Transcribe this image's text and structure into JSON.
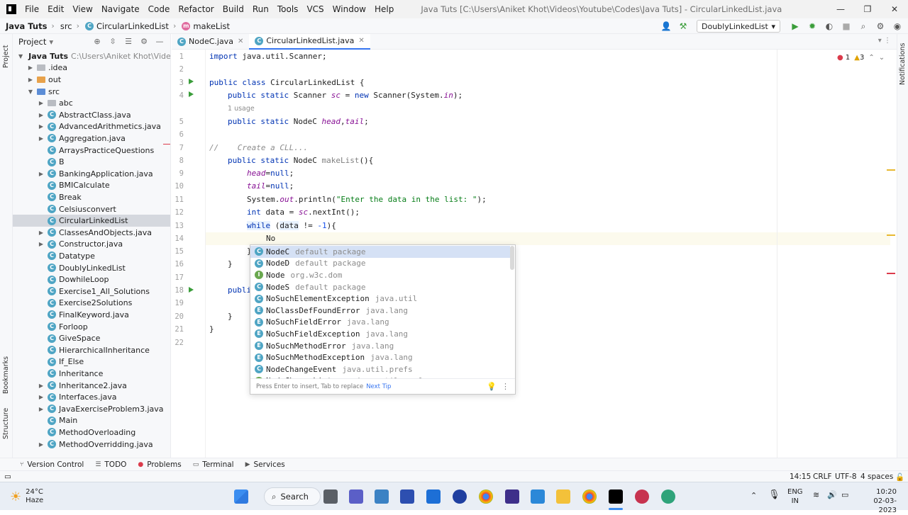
{
  "window": {
    "menu": [
      "File",
      "Edit",
      "View",
      "Navigate",
      "Code",
      "Refactor",
      "Build",
      "Run",
      "Tools",
      "VCS",
      "Window",
      "Help"
    ],
    "title": "Java Tuts [C:\\Users\\Aniket Khot\\Videos\\Youtube\\Codes\\Java Tuts] - CircularLinkedList.java",
    "controls": [
      "—",
      "❐",
      "✕"
    ]
  },
  "navbar": {
    "project": "Java Tuts",
    "src": "src",
    "file": "CircularLinkedList",
    "method": "makeList",
    "run_config": "DoublyLinkedList"
  },
  "project_panel": {
    "title": "Project",
    "root_name": "Java Tuts",
    "root_path": "C:\\Users\\Aniket Khot\\Videos\\Yo",
    "items": [
      {
        "label": ".idea",
        "type": "folder",
        "indent": 1,
        "arrow": "▶"
      },
      {
        "label": "out",
        "type": "folder-orange",
        "indent": 1,
        "arrow": "▶"
      },
      {
        "label": "src",
        "type": "folder-blue",
        "indent": 1,
        "arrow": "▼"
      },
      {
        "label": "abc",
        "type": "folder",
        "indent": 2,
        "arrow": "▶"
      },
      {
        "label": "AbstractClass.java",
        "type": "class",
        "indent": 2,
        "arrow": "▶"
      },
      {
        "label": "AdvancedArithmetics.java",
        "type": "class",
        "indent": 2,
        "arrow": "▶"
      },
      {
        "label": "Aggregation.java",
        "type": "class",
        "indent": 2,
        "arrow": "▶"
      },
      {
        "label": "ArraysPracticeQuestions",
        "type": "class",
        "indent": 2,
        "arrow": ""
      },
      {
        "label": "B",
        "type": "class",
        "indent": 2,
        "arrow": ""
      },
      {
        "label": "BankingApplication.java",
        "type": "class",
        "indent": 2,
        "arrow": "▶"
      },
      {
        "label": "BMICalculate",
        "type": "class",
        "indent": 2,
        "arrow": ""
      },
      {
        "label": "Break",
        "type": "class",
        "indent": 2,
        "arrow": ""
      },
      {
        "label": "Celsiusconvert",
        "type": "class",
        "indent": 2,
        "arrow": ""
      },
      {
        "label": "CircularLinkedList",
        "type": "class",
        "indent": 2,
        "arrow": "",
        "selected": true
      },
      {
        "label": "ClassesAndObjects.java",
        "type": "class",
        "indent": 2,
        "arrow": "▶"
      },
      {
        "label": "Constructor.java",
        "type": "class",
        "indent": 2,
        "arrow": "▶"
      },
      {
        "label": "Datatype",
        "type": "class",
        "indent": 2,
        "arrow": ""
      },
      {
        "label": "DoublyLinkedList",
        "type": "class",
        "indent": 2,
        "arrow": ""
      },
      {
        "label": "DowhileLoop",
        "type": "class",
        "indent": 2,
        "arrow": ""
      },
      {
        "label": "Exercise1_All_Solutions",
        "type": "class",
        "indent": 2,
        "arrow": ""
      },
      {
        "label": "Exercise2Solutions",
        "type": "class",
        "indent": 2,
        "arrow": ""
      },
      {
        "label": "FinalKeyword.java",
        "type": "class",
        "indent": 2,
        "arrow": ""
      },
      {
        "label": "Forloop",
        "type": "class",
        "indent": 2,
        "arrow": ""
      },
      {
        "label": "GiveSpace",
        "type": "class",
        "indent": 2,
        "arrow": ""
      },
      {
        "label": "HierarchicalInheritance",
        "type": "class",
        "indent": 2,
        "arrow": ""
      },
      {
        "label": "If_Else",
        "type": "class",
        "indent": 2,
        "arrow": ""
      },
      {
        "label": "Inheritance",
        "type": "class",
        "indent": 2,
        "arrow": ""
      },
      {
        "label": "Inheritance2.java",
        "type": "class",
        "indent": 2,
        "arrow": "▶"
      },
      {
        "label": "Interfaces.java",
        "type": "class",
        "indent": 2,
        "arrow": "▶"
      },
      {
        "label": "JavaExerciseProblem3.java",
        "type": "class",
        "indent": 2,
        "arrow": "▶"
      },
      {
        "label": "Main",
        "type": "class",
        "indent": 2,
        "arrow": ""
      },
      {
        "label": "MethodOverloading",
        "type": "class",
        "indent": 2,
        "arrow": ""
      },
      {
        "label": "MethodOverridding.java",
        "type": "class",
        "indent": 2,
        "arrow": "▶"
      }
    ]
  },
  "editor": {
    "tabs": [
      {
        "label": "NodeC.java",
        "active": false
      },
      {
        "label": "CircularLinkedList.java",
        "active": true
      }
    ],
    "inspections": {
      "errors": "1",
      "warnings": "3"
    },
    "line_numbers": [
      "1",
      "2",
      "3",
      "4",
      "",
      "5",
      "6",
      "7",
      "8",
      "9",
      "10",
      "11",
      "12",
      "13",
      "14",
      "15",
      "16",
      "17",
      "18",
      "19",
      "20",
      "21",
      "22"
    ],
    "usage_hint": "1 usage",
    "code": {
      "l1_kw": "import",
      "l1_rest": " java.util.Scanner;",
      "l3_kw": "public class",
      "l3_rest": " CircularLinkedList {",
      "l4_kw": "public static",
      "l4_a": " Scanner ",
      "l4_fld": "sc",
      "l4_b": " = ",
      "l4_kw2": "new",
      "l4_c": " Scanner(System.",
      "l4_fld2": "in",
      "l4_d": ");",
      "l5_kw": "public static",
      "l5_a": " NodeC ",
      "l5_fld": "head",
      "l5_b": ",",
      "l5_fld2": "tail",
      "l5_c": ";",
      "l7_cmt": "//    Create a CLL...",
      "l8_kw": "public static",
      "l8_a": " NodeC ",
      "l8_name": "makeList",
      "l8_b": "(){",
      "l9_fld": "head",
      "l9_a": "=",
      "l9_kw": "null",
      "l9_b": ";",
      "l10_fld": "tail",
      "l10_a": "=",
      "l10_kw": "null",
      "l10_b": ";",
      "l11_a": "System.",
      "l11_fld": "out",
      "l11_b": ".println(",
      "l11_str": "\"Enter the data in the list: \"",
      "l11_c": ");",
      "l12_kw": "int",
      "l12_a": " data = ",
      "l12_fld": "sc",
      "l12_b": ".nextInt();",
      "l13_kw": "while",
      "l13_a": " (",
      "l13_var": "data",
      "l13_b": " != ",
      "l13_num": "-1",
      "l13_c": "){",
      "l14": "No",
      "l15": "}",
      "l16": "}",
      "l18_kw": "publi",
      "l20": "}",
      "l21": "}"
    }
  },
  "completion": {
    "items": [
      {
        "kind": "C",
        "name": "NodeC",
        "pkg": "default package"
      },
      {
        "kind": "C",
        "name": "NodeD",
        "pkg": "default package"
      },
      {
        "kind": "I",
        "name": "Node",
        "pkg": "org.w3c.dom"
      },
      {
        "kind": "C",
        "name": "NodeS",
        "pkg": "default package"
      },
      {
        "kind": "C",
        "name": "NoSuchElementException",
        "pkg": "java.util"
      },
      {
        "kind": "E",
        "name": "NoClassDefFoundError",
        "pkg": "java.lang"
      },
      {
        "kind": "E",
        "name": "NoSuchFieldError",
        "pkg": "java.lang"
      },
      {
        "kind": "E",
        "name": "NoSuchFieldException",
        "pkg": "java.lang"
      },
      {
        "kind": "E",
        "name": "NoSuchMethodError",
        "pkg": "java.lang"
      },
      {
        "kind": "E",
        "name": "NoSuchMethodException",
        "pkg": "java.lang"
      },
      {
        "kind": "C",
        "name": "NodeChangeEvent",
        "pkg": "java.util.prefs"
      },
      {
        "kind": "I",
        "name": "NodeChangeListener",
        "pkg": "java.util.prefs"
      }
    ],
    "footer": "Press Enter to insert, Tab to replace",
    "tip": "Next Tip"
  },
  "stripes": {
    "project": "Project",
    "bookmarks": "Bookmarks",
    "structure": "Structure",
    "notifications": "Notifications"
  },
  "bottom_tools": [
    "Version Control",
    "TODO",
    "Problems",
    "Terminal",
    "Services"
  ],
  "status": {
    "position": "14:15",
    "line_sep": "CRLF",
    "encoding": "UTF-8",
    "indent": "4 spaces"
  },
  "taskbar": {
    "weather_temp": "24°C",
    "weather_desc": "Haze",
    "search": "Search",
    "lang": "ENG",
    "region": "IN",
    "time": "10:20",
    "date": "02-03-2023"
  },
  "colors": {
    "accent": "#3574f0",
    "keyword": "#0033b3",
    "field": "#871094",
    "string": "#067d17"
  }
}
